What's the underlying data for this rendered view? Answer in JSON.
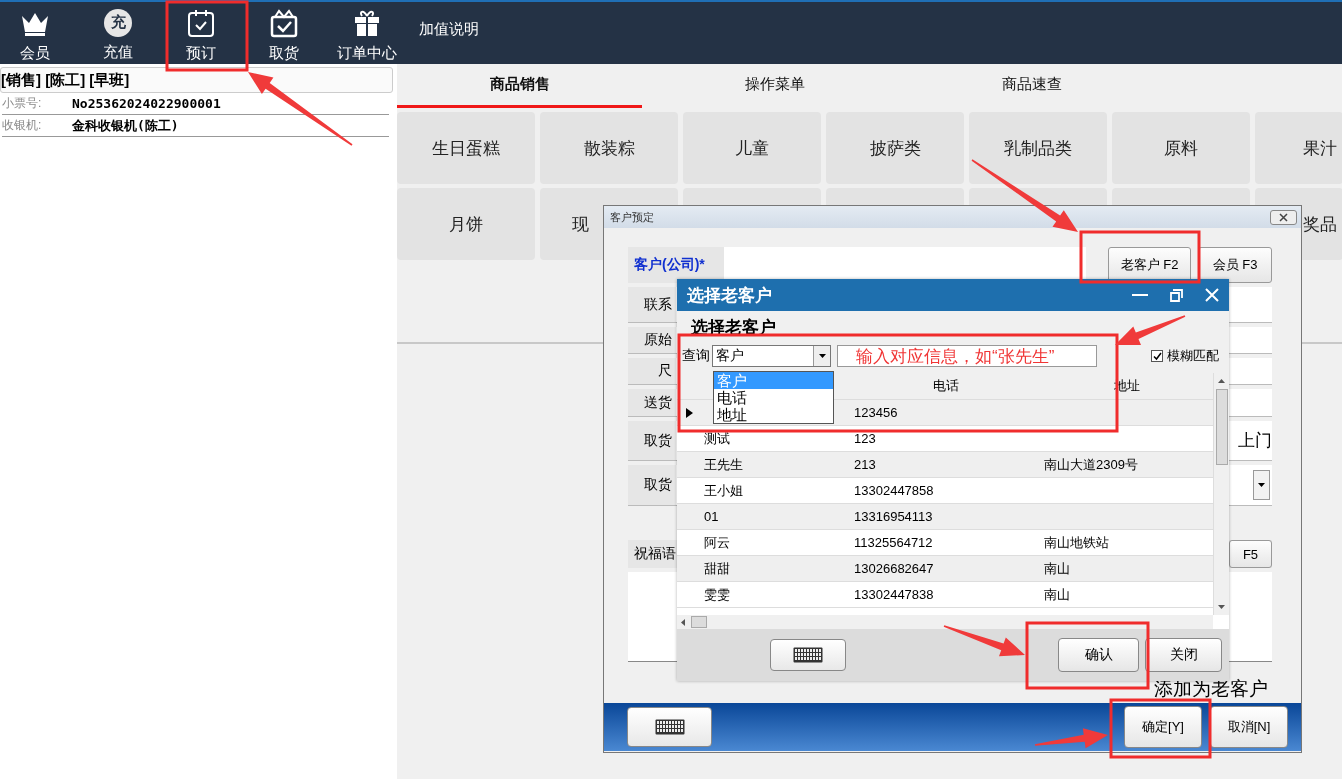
{
  "top_nav": {
    "items": [
      {
        "label": "会员",
        "kind": "crown"
      },
      {
        "label": "充值",
        "kind": "badge",
        "badge_text": "充"
      },
      {
        "label": "预订",
        "kind": "calendar"
      },
      {
        "label": "取货",
        "kind": "box"
      },
      {
        "label": "订单中心",
        "kind": "gift"
      }
    ],
    "link": "加值说明"
  },
  "left_panel": {
    "header": "[销售] [陈工] [早班]",
    "fields": [
      {
        "label": "小票号:",
        "value": "No25362024022900001"
      },
      {
        "label": "收银机:",
        "value": "金科收银机(陈工)"
      }
    ]
  },
  "tabs": [
    {
      "label": "商品销售",
      "selected": true
    },
    {
      "label": "操作菜单",
      "selected": false
    },
    {
      "label": "商品速查",
      "selected": false
    }
  ],
  "categories": {
    "row_1": [
      "生日蛋糕",
      "散装粽",
      "儿童",
      "披萨类",
      "乳制品类",
      "原料",
      "果汁"
    ],
    "row_2_left": [
      "月饼",
      "现"
    ],
    "row_2_right": [
      "奖品"
    ]
  },
  "booking_dialog": {
    "title": "客户预定",
    "customer_label": "客户(公司)*",
    "buttons": [
      "老客户 F2",
      "会员 F3"
    ],
    "rows": [
      {
        "label": "联系",
        "kind": "text"
      },
      {
        "label": "原始",
        "kind": "text"
      },
      {
        "label": "尺",
        "kind": "text"
      },
      {
        "label": "送货",
        "kind": "text"
      },
      {
        "label": "取货",
        "kind": "radio",
        "option": "上门"
      },
      {
        "label": "取货",
        "kind": "select"
      }
    ],
    "blessing": {
      "label": "祝福语",
      "button": "F5"
    },
    "option_text": "添加为老客户",
    "footer_buttons": [
      "确定[Y]",
      "取消[N]"
    ]
  },
  "customer_dialog": {
    "title": "选择老客户",
    "heading": "选择老客户",
    "query_label": "查询",
    "query_value": "客户",
    "options": [
      {
        "label": "客户",
        "selected": true
      },
      {
        "label": "电话",
        "selected": false
      },
      {
        "label": "地址",
        "selected": false
      }
    ],
    "fuzzy": {
      "label": "模糊匹配",
      "checked": true
    },
    "columns": [
      "电话",
      "地址"
    ],
    "rows": [
      {
        "phone": "123456",
        "current": true
      },
      {
        "name": "测试",
        "phone": "123",
        "current": false
      },
      {
        "name": "王先生",
        "phone": "213",
        "address": "南山大道2309号",
        "current": false
      },
      {
        "name": "王小姐",
        "phone": "13302447858",
        "current": false
      },
      {
        "name": "01",
        "phone": "13316954113",
        "current": false
      },
      {
        "name": "阿云",
        "phone": "11325564712",
        "address": "南山地铁站",
        "current": false
      },
      {
        "name": "甜甜",
        "phone": "13026682647",
        "address": "南山",
        "current": false
      },
      {
        "name": "雯雯",
        "phone": "13302447838",
        "address": "南山",
        "current": false
      }
    ],
    "buttons": [
      "确认",
      "关闭"
    ]
  },
  "annotation": {
    "hint_text": "输入对应信息，如“张先生”"
  }
}
